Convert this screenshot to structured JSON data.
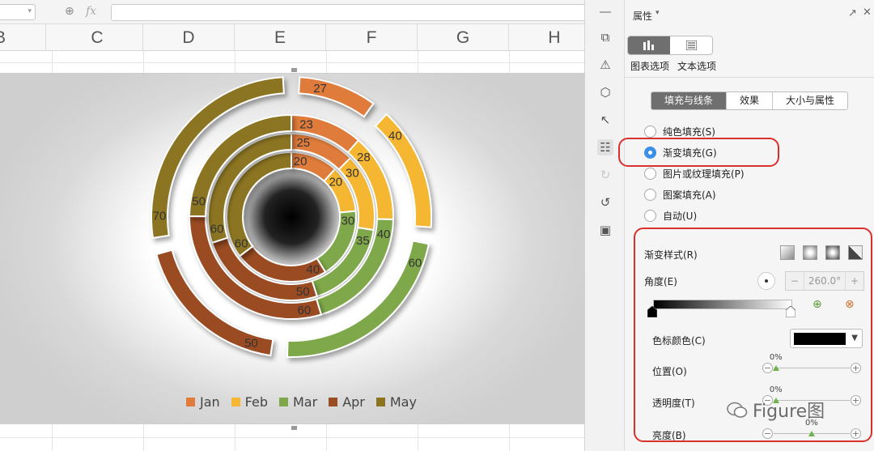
{
  "formula_bar": {
    "fx": "fx"
  },
  "columns": [
    "B",
    "C",
    "D",
    "E",
    "F",
    "G",
    "H"
  ],
  "chart_data": {
    "type": "doughnut",
    "categories": [
      "Jan",
      "Feb",
      "Mar",
      "Apr",
      "May"
    ],
    "colors": [
      "#e07b3a",
      "#f5b731",
      "#7ea84a",
      "#9a4c23",
      "#8c7420"
    ],
    "series": [
      {
        "values": [
          20,
          20,
          30,
          40,
          60
        ]
      },
      {
        "values": [
          25,
          30,
          35,
          50,
          60
        ]
      },
      {
        "values": [
          23,
          28,
          40,
          60,
          50
        ]
      },
      {
        "values": [
          27,
          40,
          60,
          50,
          70
        ]
      }
    ],
    "legend": "bottom"
  },
  "panel": {
    "title": "属性",
    "tabs": [
      "图表选项",
      "文本选项"
    ],
    "sub_tabs": [
      "填充与线条",
      "效果",
      "大小与属性"
    ],
    "fill_options": [
      {
        "label": "纯色填充(S)",
        "checked": false
      },
      {
        "label": "渐变填充(G)",
        "checked": true
      },
      {
        "label": "图片或纹理填充(P)",
        "checked": false
      },
      {
        "label": "图案填充(A)",
        "checked": false
      },
      {
        "label": "自动(U)",
        "checked": false
      }
    ],
    "gradient": {
      "style_label": "渐变样式(R)",
      "angle_label": "角度(E)",
      "angle_value": "260.0°",
      "stop_color_label": "色标颜色(C)",
      "stop_color": "#000000",
      "position_label": "位置(O)",
      "position_value": "0%",
      "position_fraction": 0.03,
      "transparency_label": "透明度(T)",
      "transparency_value": "0%",
      "transparency_fraction": 0.03,
      "brightness_label": "亮度(B)",
      "brightness_value": "0%",
      "brightness_fraction": 0.5
    }
  },
  "watermark": "Figure图"
}
